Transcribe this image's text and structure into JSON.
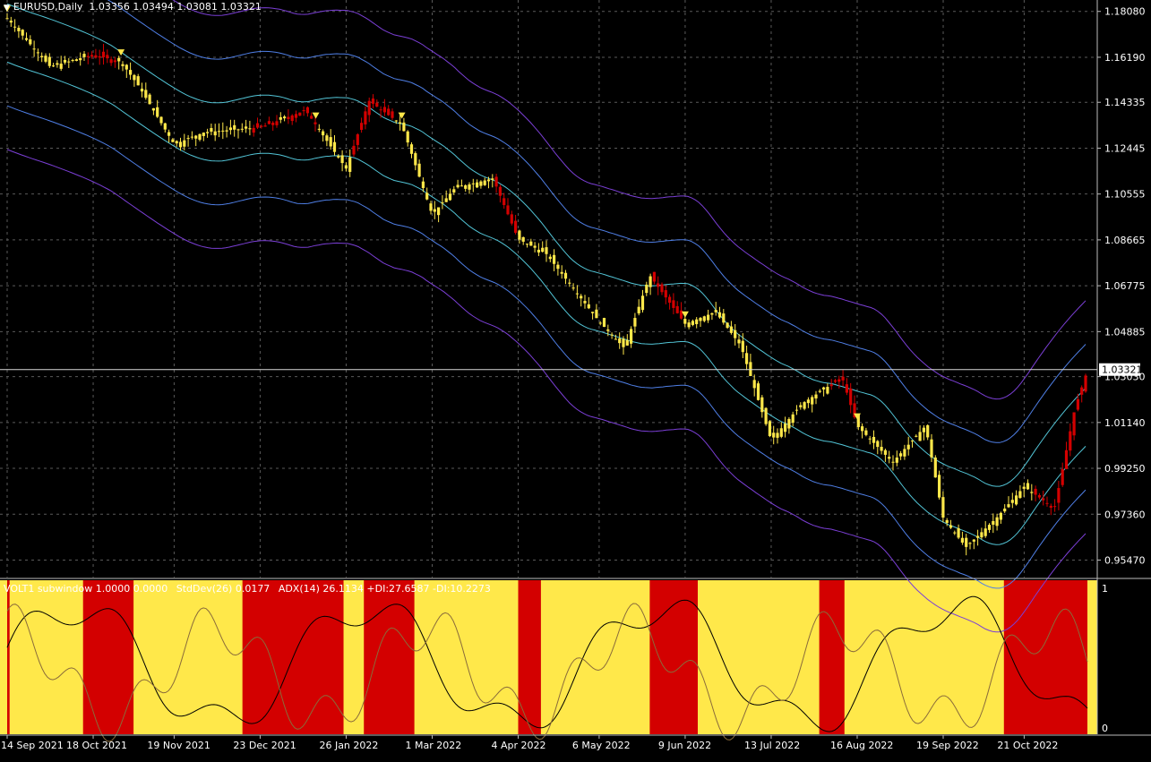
{
  "header": {
    "symbol": "EURUSD,Daily",
    "ohlc": "1.03356 1.03494 1.03081 1.03321"
  },
  "subwindow": {
    "title": "VOLT1 subwindow 1.0000 0.0000",
    "stddev": "StdDev(26) 0.0177",
    "adx": "ADX(14) 26.1134 +DI:27.6587 -DI:10.2273",
    "scale_top": "1",
    "scale_bottom": "0"
  },
  "colors": {
    "background": "#000000",
    "grid": "#5a5a5a",
    "bull_candle": "#ffe84a",
    "bear_candle": "#d30000",
    "bull_zone": "#ffe84a",
    "bear_zone": "#d30000",
    "band_outer": "#7b3fd6",
    "band_mid": "#4f7fe6",
    "band_inner": "#52c4d6",
    "price_line": "#d9d9d9",
    "adx_line": "#000000",
    "stddev_line": "#8a6b3a",
    "scale_text": "#ffffff"
  },
  "chart_data": {
    "type": "candlestick",
    "title": "EURUSD,Daily",
    "last_price": "1.03321",
    "ylim": [
      0.9475,
      1.1855
    ],
    "y_ticks": [
      "1.18080",
      "1.16190",
      "1.14335",
      "1.12445",
      "1.10555",
      "1.08665",
      "1.06775",
      "1.04885",
      "1.03030",
      "1.01140",
      "0.99250",
      "0.97360",
      "0.95470"
    ],
    "x_ticks": [
      "14 Sep 2021",
      "18 Oct 2021",
      "19 Nov 2021",
      "23 Dec 2021",
      "26 Jan 2022",
      "1 Mar 2022",
      "4 Apr 2022",
      "6 May 2022",
      "9 Jun 2022",
      "13 Jul 2022",
      "16 Aug 2022",
      "19 Sep 2022",
      "21 Oct 2022"
    ],
    "grid": true,
    "close_series": [
      {
        "date": "14 Sep 2021",
        "close": 1.178
      },
      {
        "date": "1 Oct 2021",
        "close": 1.158
      },
      {
        "date": "18 Oct 2021",
        "close": 1.163
      },
      {
        "date": "29 Oct 2021",
        "close": 1.16
      },
      {
        "date": "5 Nov 2021",
        "close": 1.15
      },
      {
        "date": "19 Nov 2021",
        "close": 1.126
      },
      {
        "date": "1 Dec 2021",
        "close": 1.131
      },
      {
        "date": "23 Dec 2021",
        "close": 1.133
      },
      {
        "date": "10 Jan 2022",
        "close": 1.14
      },
      {
        "date": "26 Jan 2022",
        "close": 1.116
      },
      {
        "date": "4 Feb 2022",
        "close": 1.144
      },
      {
        "date": "17 Feb 2022",
        "close": 1.134
      },
      {
        "date": "1 Mar 2022",
        "close": 1.097
      },
      {
        "date": "10 Mar 2022",
        "close": 1.108
      },
      {
        "date": "25 Mar 2022",
        "close": 1.112
      },
      {
        "date": "4 Apr 2022",
        "close": 1.087
      },
      {
        "date": "15 Apr 2022",
        "close": 1.081
      },
      {
        "date": "6 May 2022",
        "close": 1.053
      },
      {
        "date": "16 May 2022",
        "close": 1.042
      },
      {
        "date": "26 May 2022",
        "close": 1.072
      },
      {
        "date": "9 Jun 2022",
        "close": 1.052
      },
      {
        "date": "21 Jun 2022",
        "close": 1.057
      },
      {
        "date": "1 Jul 2022",
        "close": 1.043
      },
      {
        "date": "13 Jul 2022",
        "close": 1.004
      },
      {
        "date": "25 Jul 2022",
        "close": 1.019
      },
      {
        "date": "10 Aug 2022",
        "close": 1.03
      },
      {
        "date": "16 Aug 2022",
        "close": 1.01
      },
      {
        "date": "30 Aug 2022",
        "close": 0.995
      },
      {
        "date": "12 Sep 2022",
        "close": 1.01
      },
      {
        "date": "19 Sep 2022",
        "close": 0.972
      },
      {
        "date": "28 Sep 2022",
        "close": 0.96
      },
      {
        "date": "10 Oct 2022",
        "close": 0.972
      },
      {
        "date": "21 Oct 2022",
        "close": 0.985
      },
      {
        "date": "2 Nov 2022",
        "close": 0.976
      },
      {
        "date": "10 Nov 2022",
        "close": 1.017
      },
      {
        "date": "15 Nov 2022",
        "close": 1.033
      }
    ],
    "bear_segments": [
      {
        "from": "15 Oct 2021",
        "to": "28 Oct 2021"
      },
      {
        "from": "20 Dec 2021",
        "to": "31 Dec 2021"
      },
      {
        "from": "3 Jan 2022",
        "to": "14 Jan 2022"
      },
      {
        "from": "28 Jan 2022",
        "to": "14 Feb 2022"
      },
      {
        "from": "25 Mar 2022",
        "to": "4 Apr 2022"
      },
      {
        "from": "27 May 2022",
        "to": "8 Jun 2022"
      },
      {
        "from": "5 Aug 2022",
        "to": "15 Aug 2022"
      },
      {
        "from": "25 Oct 2022",
        "to": "15 Nov 2022"
      }
    ],
    "subwindow_zones": [
      {
        "state": "bear",
        "from": "14 Sep 2021",
        "to": "15 Sep 2021"
      },
      {
        "state": "bull",
        "from": "15 Sep 2021",
        "to": "14 Oct 2021"
      },
      {
        "state": "bear",
        "from": "14 Oct 2021",
        "to": "3 Nov 2021"
      },
      {
        "state": "bull",
        "from": "3 Nov 2021",
        "to": "16 Dec 2021"
      },
      {
        "state": "bear",
        "from": "16 Dec 2021",
        "to": "25 Jan 2022"
      },
      {
        "state": "bull",
        "from": "25 Jan 2022",
        "to": "2 Feb 2022"
      },
      {
        "state": "bear",
        "from": "2 Feb 2022",
        "to": "22 Feb 2022"
      },
      {
        "state": "bull",
        "from": "22 Feb 2022",
        "to": "4 Apr 2022"
      },
      {
        "state": "bear",
        "from": "4 Apr 2022",
        "to": "13 Apr 2022"
      },
      {
        "state": "bull",
        "from": "13 Apr 2022",
        "to": "26 May 2022"
      },
      {
        "state": "bear",
        "from": "26 May 2022",
        "to": "14 Jun 2022"
      },
      {
        "state": "bull",
        "from": "14 Jun 2022",
        "to": "1 Aug 2022"
      },
      {
        "state": "bear",
        "from": "1 Aug 2022",
        "to": "11 Aug 2022"
      },
      {
        "state": "bull",
        "from": "11 Aug 2022",
        "to": "13 Oct 2022"
      },
      {
        "state": "bear",
        "from": "13 Oct 2022",
        "to": "15 Nov 2022"
      }
    ]
  }
}
